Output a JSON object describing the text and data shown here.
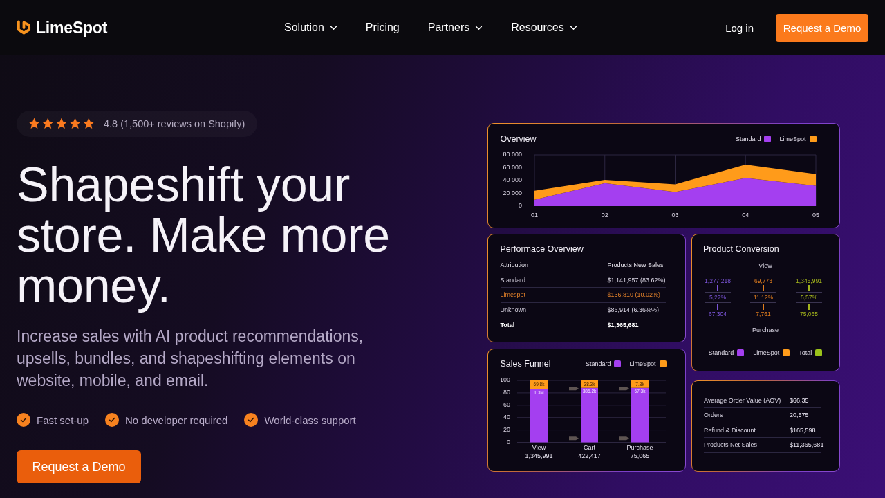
{
  "header": {
    "logo": "LimeSpot",
    "nav": [
      {
        "label": "Solution",
        "has_menu": true
      },
      {
        "label": "Pricing",
        "has_menu": false
      },
      {
        "label": "Partners",
        "has_menu": true
      },
      {
        "label": "Resources",
        "has_menu": true
      }
    ],
    "login": "Log in",
    "cta": "Request a Demo"
  },
  "hero": {
    "rating": {
      "stars": 5,
      "text": "4.8 (1,500+ reviews on Shopify)"
    },
    "headline": "Shapeshift your store. Make more money.",
    "subtext": "Increase sales with AI product recommendations, upsells, bundles, and shapeshifting elements on website, mobile, and email.",
    "features": [
      "Fast set-up",
      "No developer required",
      "World-class support"
    ],
    "cta": "Request a Demo"
  },
  "dashboard": {
    "overview": {
      "chart_data": {
        "type": "area",
        "title": "Overview",
        "categories": [
          "01",
          "02",
          "03",
          "04",
          "05"
        ],
        "series": [
          {
            "name": "Standard",
            "color": "#a43ff0",
            "values": [
              10000,
              36000,
              22000,
              44000,
              32000
            ]
          },
          {
            "name": "LimeSpot",
            "color": "#ff9b1a",
            "values": [
              14000,
              5000,
              12000,
              21000,
              18000
            ]
          }
        ],
        "stacked": true,
        "grid": true,
        "ylim": [
          0,
          80000
        ],
        "yticks": [
          {
            "value": 0,
            "label": "0"
          },
          {
            "value": 20000,
            "label": "20 000"
          },
          {
            "value": 40000,
            "label": "40 000"
          },
          {
            "value": 60000,
            "label": "60 000"
          },
          {
            "value": 80000,
            "label": "80 000"
          }
        ]
      }
    },
    "performance": {
      "title": "Performace Overview",
      "columns": [
        "Attribution",
        "Products New Sales"
      ],
      "rows": [
        {
          "kind": "plain",
          "cells": [
            "Standard",
            "$1,141,957 (83.62%)"
          ]
        },
        {
          "kind": "accent",
          "cells": [
            "Limespot",
            "$136,810 (10.02%)"
          ]
        },
        {
          "kind": "plain",
          "cells": [
            "Unknown",
            "$86,914 (6.36%%)"
          ]
        },
        {
          "kind": "total",
          "cells": [
            "Total",
            "$1,365,681"
          ]
        }
      ]
    },
    "conversion": {
      "title": "Product Conversion",
      "top_label": "View",
      "bottom_label": "Purchase",
      "columns": [
        {
          "color": "#7b55d8",
          "view_count": "1,277,218",
          "rate": "5,27%",
          "purchase_count": "67,304"
        },
        {
          "color": "#e07d1e",
          "view_count": "69,773",
          "rate": "11.12%",
          "purchase_count": "7,761"
        },
        {
          "color": "#a2b31c",
          "view_count": "1,345,991",
          "rate": "5,57%",
          "purchase_count": "75,065"
        }
      ],
      "legend": [
        {
          "label": "Standard",
          "color": "#a43ff0"
        },
        {
          "label": "LimeSpot",
          "color": "#ff9b1a"
        },
        {
          "label": "Total",
          "color": "#9bc21b"
        }
      ]
    },
    "sales_funnel": {
      "chart_data": {
        "type": "bar",
        "title": "Sales Funnel",
        "categories": [
          "View",
          "Cart",
          "Purchase"
        ],
        "series": [
          {
            "name": "Standard",
            "color": "#a43ff0",
            "values": [
              86,
              88,
              88
            ]
          },
          {
            "name": "LimeSpot",
            "color": "#ff9b1a",
            "values": [
              14,
              12,
              12
            ]
          }
        ],
        "stacked": true,
        "grid": true,
        "ylim": [
          0,
          100
        ],
        "yticks": [
          0,
          20,
          40,
          60,
          80,
          100
        ],
        "annotations": [
          {
            "x": "View",
            "y": 86,
            "text": "1.3M"
          },
          {
            "x": "Cart",
            "y": 88,
            "text": "386.2k"
          },
          {
            "x": "Purchase",
            "y": 88,
            "text": "67.3k"
          },
          {
            "x": "View",
            "y": 100,
            "text": "69.8k"
          },
          {
            "x": "Cart",
            "y": 100,
            "text": "38.3k"
          },
          {
            "x": "Purchase",
            "y": 100,
            "text": "7.8k"
          }
        ]
      },
      "totals": [
        "1,345,991",
        "422,417",
        "75,065"
      ]
    },
    "summary": {
      "rows": [
        {
          "label": "Average Order Value (AOV)",
          "value": "$66.35"
        },
        {
          "label": "Orders",
          "value": "20,575"
        },
        {
          "label": "Refund & Discount",
          "value": "$165,598"
        },
        {
          "label": "Products Net Sales",
          "value": "$11,365,681"
        }
      ]
    }
  }
}
